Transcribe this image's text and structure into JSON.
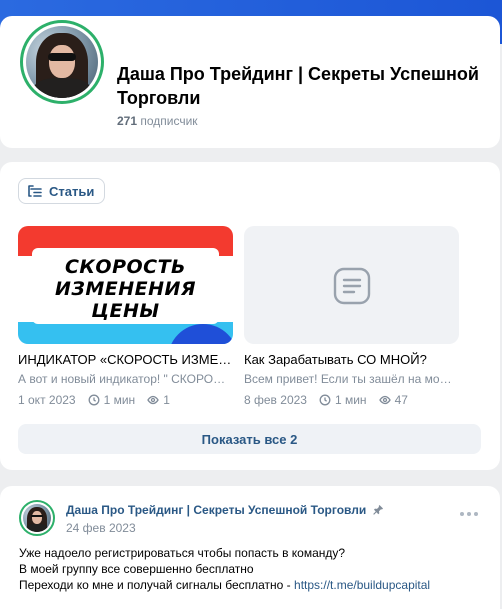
{
  "header": {
    "title": "Даша Про Трейдинг | Секреты Успешной Торговли",
    "subscribers_count": "271",
    "subscribers_label": "подписчик"
  },
  "articles_block": {
    "tab_label": "Статьи",
    "items": [
      {
        "cover_text": "СКОРОСТЬ ИЗМЕНЕНИЯ ЦЕНЫ",
        "title": "ИНДИКАТОР «СКОРОСТЬ ИЗМЕНЕНИЯ ЦЕНЫ»",
        "desc": "А вот и новый индикатор! \" СКОРОСТЬ ИЗМЕНЕНИЯ ЦЕНЫ\"",
        "date": "1 окт 2023",
        "read_time": "1 мин",
        "views": "1"
      },
      {
        "cover_text": "",
        "title": "Как Зарабатывать СО МНОЙ?",
        "desc": "Всем привет! Если ты зашёл на мою страницу",
        "date": "8 фев 2023",
        "read_time": "1 мин",
        "views": "47"
      }
    ],
    "show_all_label": "Показать все 2"
  },
  "post": {
    "author": "Даша Про Трейдинг | Секреты Успешной Торговли",
    "date": "24 фев 2023",
    "line1": "Уже надоело регистрироваться чтобы попасть в команду?",
    "line2": "В моей группу все совершенно бесплатно",
    "line3": "Переходи ко мне и получай сигналы бесплатно - ",
    "link": "https://t.me/buildupcapital"
  },
  "icons": {
    "articles": "articles-icon",
    "clock": "clock-icon",
    "views": "eye-icon",
    "pin": "pin-icon",
    "more": "more-icon",
    "placeholder": "article-placeholder-icon"
  },
  "colors": {
    "accent_blue": "#2a5885",
    "top_band": "#2b6ae0",
    "avatar_ring": "#2db06a"
  }
}
